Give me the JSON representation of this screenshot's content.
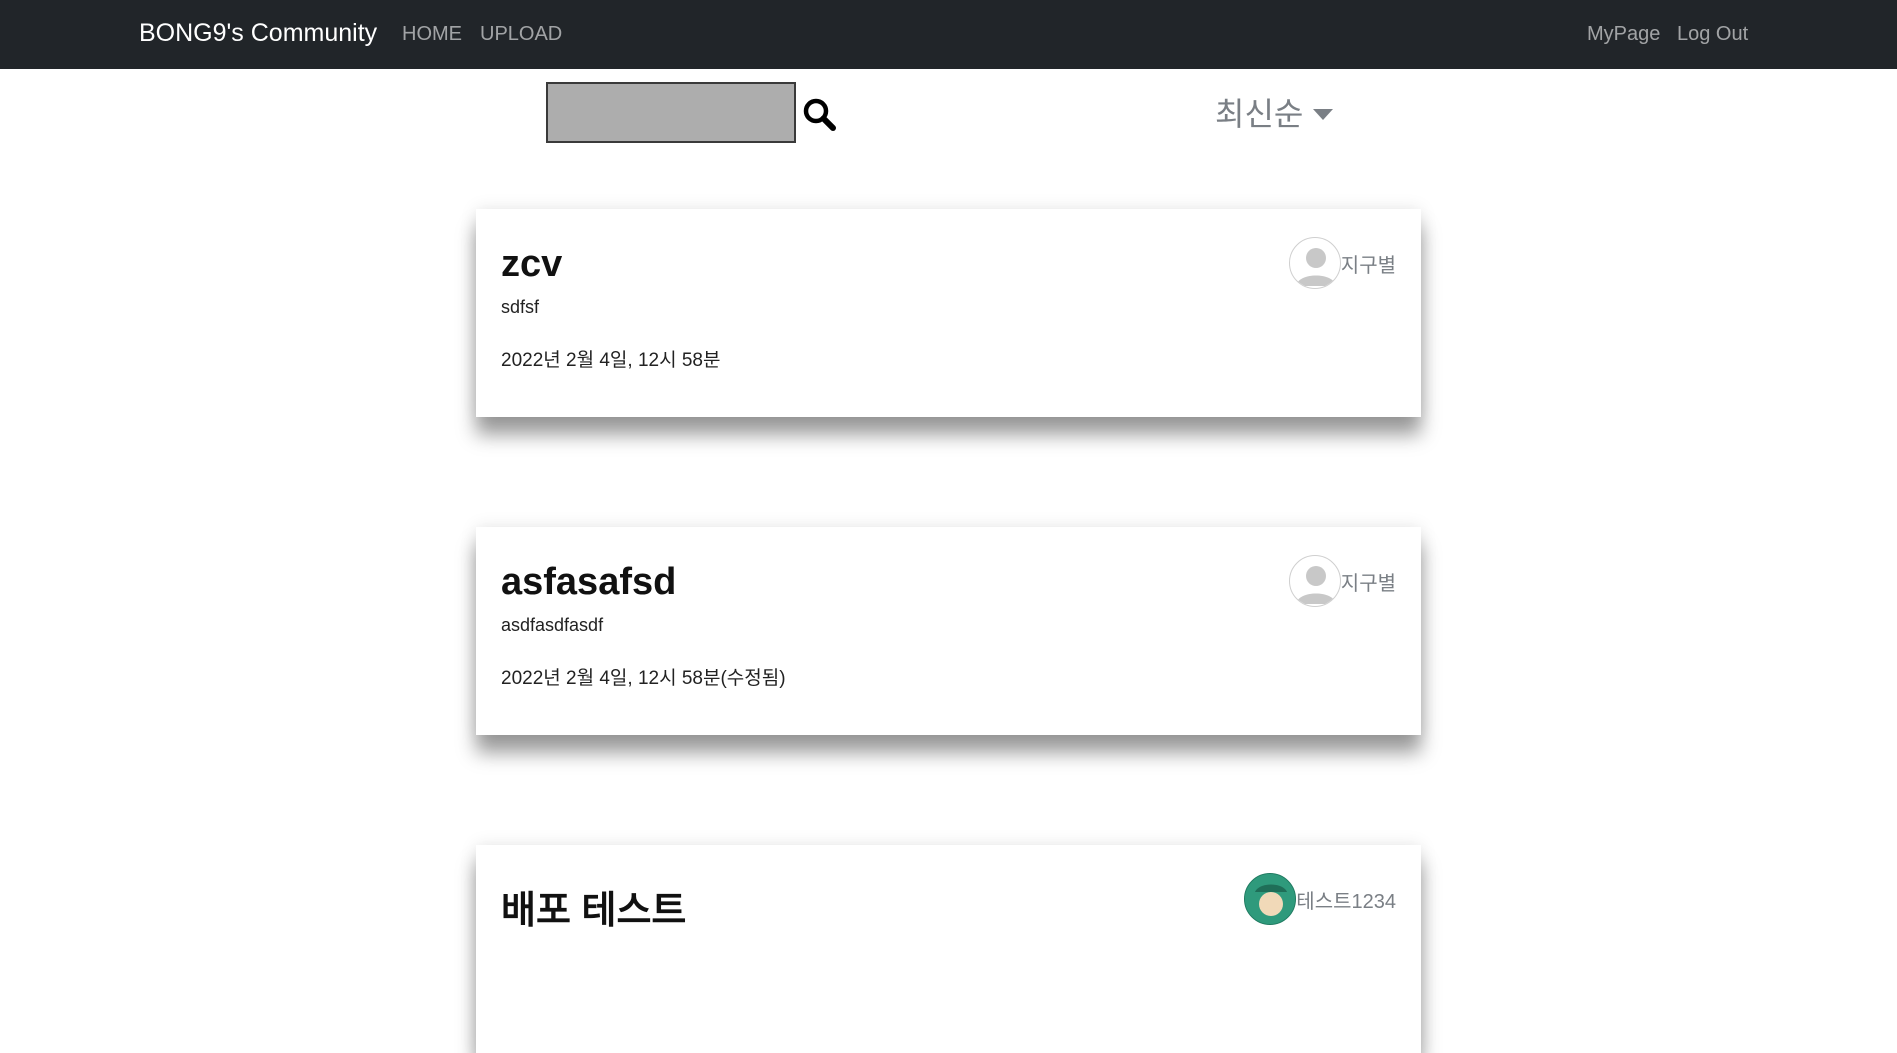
{
  "navbar": {
    "brand": "BONG9's Community",
    "home": "HOME",
    "upload": "UPLOAD",
    "mypage": "MyPage",
    "logout": "Log Out"
  },
  "search": {
    "value": "",
    "placeholder": ""
  },
  "sort": {
    "label": "최신순"
  },
  "posts": [
    {
      "title": "zcv",
      "body": "sdfsf",
      "date": "2022년 2월 4일, 12시 58분",
      "author": "지구별",
      "avatar": "default-avatar-icon"
    },
    {
      "title": "asfasafsd",
      "body": "asdfasdfasdf",
      "date": "2022년 2월 4일, 12시 58분(수정됨)",
      "author": "지구별",
      "avatar": "default-avatar-icon"
    },
    {
      "title": "배포 테스트",
      "body": "",
      "date": "",
      "author": "테스트1234",
      "avatar": "character-avatar-icon"
    }
  ],
  "colors": {
    "navbar": "#212529",
    "nav_link": "#9a9da0",
    "search_bg": "#adadad",
    "muted_text": "#7a7f85",
    "avatar_green": "#2f9a7c"
  }
}
